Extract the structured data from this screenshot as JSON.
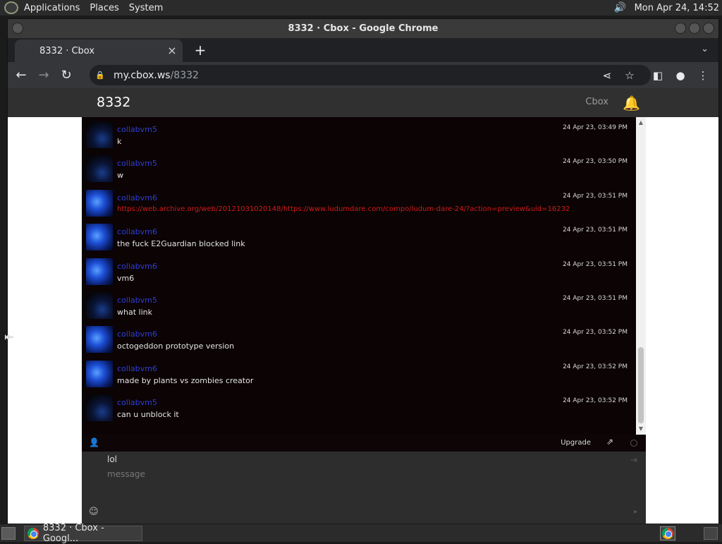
{
  "top_panel": {
    "menus": [
      "Applications",
      "Places",
      "System"
    ],
    "clock": "Mon Apr 24, 14:52"
  },
  "window": {
    "title": "8332 · Cbox - Google Chrome"
  },
  "tab": {
    "label": "8332 · Cbox",
    "close": "×",
    "new_tab": "+"
  },
  "address_bar": {
    "host": "my.cbox.ws",
    "path": "/8332"
  },
  "app_header": {
    "title": "8332",
    "brand": "Cbox"
  },
  "messages": [
    {
      "user": "collabvm5",
      "time": "24 Apr 23, 03:49 PM",
      "text": "k",
      "avatar": "dark",
      "type": "text"
    },
    {
      "user": "collabvm5",
      "time": "24 Apr 23, 03:50 PM",
      "text": "w",
      "avatar": "dark",
      "type": "text"
    },
    {
      "user": "collabvm6",
      "time": "24 Apr 23, 03:51 PM",
      "text": "https://web.archive.org/web/20121031020148/https://www.ludumdare.com/compo/ludum-dare-24/?action=preview&uid=16232",
      "avatar": "blue",
      "type": "link"
    },
    {
      "user": "collabvm6",
      "time": "24 Apr 23, 03:51 PM",
      "text": "the fuck E2Guardian blocked link",
      "avatar": "blue",
      "type": "text"
    },
    {
      "user": "collabvm6",
      "time": "24 Apr 23, 03:51 PM",
      "text": "vm6",
      "avatar": "blue",
      "type": "text"
    },
    {
      "user": "collabvm5",
      "time": "24 Apr 23, 03:51 PM",
      "text": "what link",
      "avatar": "dark",
      "type": "text"
    },
    {
      "user": "collabvm6",
      "time": "24 Apr 23, 03:52 PM",
      "text": "octogeddon prototype version",
      "avatar": "blue",
      "type": "text"
    },
    {
      "user": "collabvm6",
      "time": "24 Apr 23, 03:52 PM",
      "text": "made by plants vs zombies creator",
      "avatar": "blue",
      "type": "text"
    },
    {
      "user": "collabvm5",
      "time": "24 Apr 23, 03:52 PM",
      "text": "can u unblock it",
      "avatar": "dark",
      "type": "text"
    }
  ],
  "chat_bar": {
    "upgrade_label": "Upgrade"
  },
  "composer": {
    "name_value": "lol",
    "message_placeholder": "message"
  },
  "taskbar": {
    "task_label": "8332 · Cbox - Googl..."
  },
  "colors": {
    "chat_bg": "#0b0304",
    "username": "#2f3fd8",
    "link": "#d11a1a"
  }
}
